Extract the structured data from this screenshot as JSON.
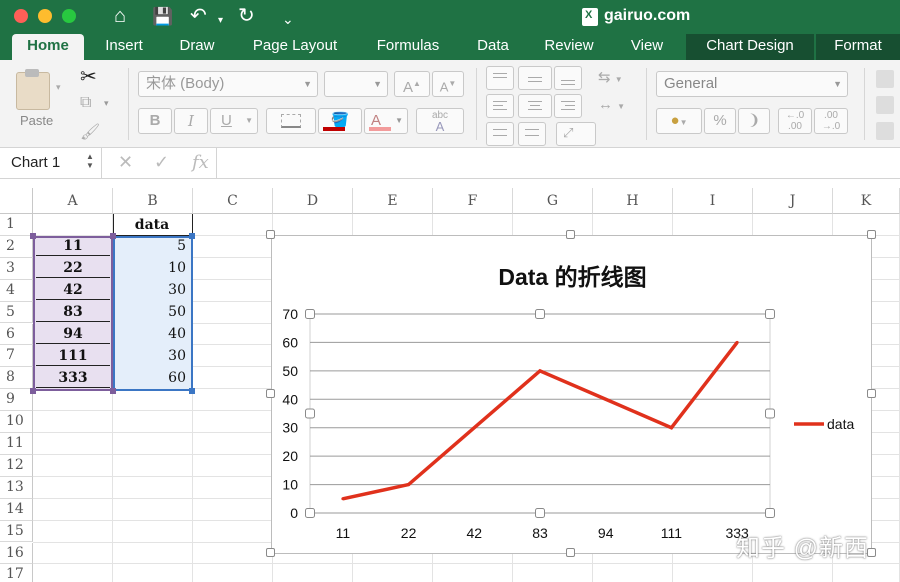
{
  "window": {
    "title": "gairuo.com"
  },
  "quick_access": {
    "home_icon": "⌂",
    "save_icon": "💾",
    "undo_icon": "↶",
    "dropdown_icon": "▾",
    "redo_icon": "↻",
    "more_icon": "⌄"
  },
  "ribbon": {
    "tabs": [
      "Home",
      "Insert",
      "Draw",
      "Page Layout",
      "Formulas",
      "Data",
      "Review",
      "View",
      "Chart Design",
      "Format"
    ],
    "active_tab": "Home",
    "paste_label": "Paste",
    "font_name": "宋体 (Body)",
    "font_size": "",
    "grow_font": "A",
    "shrink_font": "A",
    "bold": "B",
    "italic": "I",
    "underline": "U",
    "number_format": "General",
    "percent": "%",
    "comma": "❩",
    "increase_decimal_top": "←.0",
    "increase_decimal_bottom": ".00",
    "decrease_decimal_top": ".00",
    "decrease_decimal_bottom": "→.0",
    "wrap_text_label": "abc"
  },
  "formula_bar": {
    "name_box": "Chart 1",
    "cancel_icon": "✕",
    "enter_icon": "✓",
    "fx": "fx",
    "formula": ""
  },
  "sheet": {
    "columns": [
      "A",
      "B",
      "C",
      "D",
      "E",
      "F",
      "G",
      "H",
      "I",
      "J",
      "K"
    ],
    "rows": [
      "1",
      "2",
      "3",
      "4",
      "5",
      "6",
      "7",
      "8",
      "9",
      "10",
      "11",
      "12",
      "13",
      "14",
      "15",
      "16",
      "17"
    ],
    "header_b": "data",
    "col_a": [
      "11",
      "22",
      "42",
      "83",
      "94",
      "111",
      "333"
    ],
    "col_b": [
      "5",
      "10",
      "30",
      "50",
      "40",
      "30",
      "60"
    ]
  },
  "chart_data": {
    "type": "line",
    "title": "Data 的折线图",
    "categories": [
      "11",
      "22",
      "42",
      "83",
      "94",
      "111",
      "333"
    ],
    "series": [
      {
        "name": "data",
        "values": [
          5,
          10,
          30,
          50,
          40,
          30,
          60
        ],
        "color": "#e0311c"
      }
    ],
    "ylim": [
      0,
      70
    ],
    "yticks": [
      "0",
      "10",
      "20",
      "30",
      "40",
      "50",
      "60",
      "70"
    ],
    "grid": true,
    "legend": "right"
  },
  "watermark": "知乎 @新西"
}
